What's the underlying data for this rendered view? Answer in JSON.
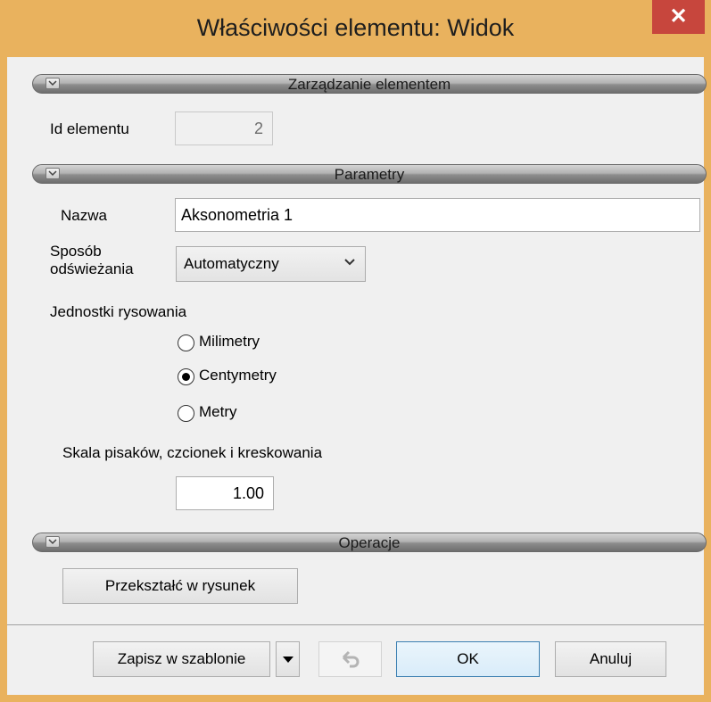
{
  "window": {
    "title": "Właściwości elementu: Widok",
    "close_glyph": "✕"
  },
  "sections": {
    "management": {
      "title": "Zarządzanie elementem"
    },
    "parameters": {
      "title": "Parametry"
    },
    "operations": {
      "title": "Operacje"
    }
  },
  "management": {
    "id_label": "Id elementu",
    "id_value": "2"
  },
  "parameters": {
    "name_label": "Nazwa",
    "name_value": "Aksonometria 1",
    "refresh_label_line1": "Sposób",
    "refresh_label_line2": "odświeżania",
    "refresh_value": "Automatyczny",
    "units_label": "Jednostki rysowania",
    "units": [
      {
        "label": "Milimetry",
        "selected": false
      },
      {
        "label": "Centymetry",
        "selected": true
      },
      {
        "label": "Metry",
        "selected": false
      }
    ],
    "scale_label": "Skala pisaków, czcionek i kreskowania",
    "scale_value": "1.00"
  },
  "operations": {
    "convert_label": "Przekształć w rysunek"
  },
  "footer": {
    "save_template_label": "Zapisz w szablonie",
    "ok_label": "OK",
    "cancel_label": "Anuluj"
  },
  "icons": {
    "collapse": "chevron-down-icon",
    "dropdown": "chevron-down-icon",
    "split_dropdown": "triangle-down-icon",
    "undo": "undo-icon",
    "close": "close-icon"
  },
  "colors": {
    "title_bar": "#e9b25e",
    "close_button": "#c7463d",
    "client_bg": "#f0f0f0",
    "ok_border": "#3c7fb1"
  }
}
